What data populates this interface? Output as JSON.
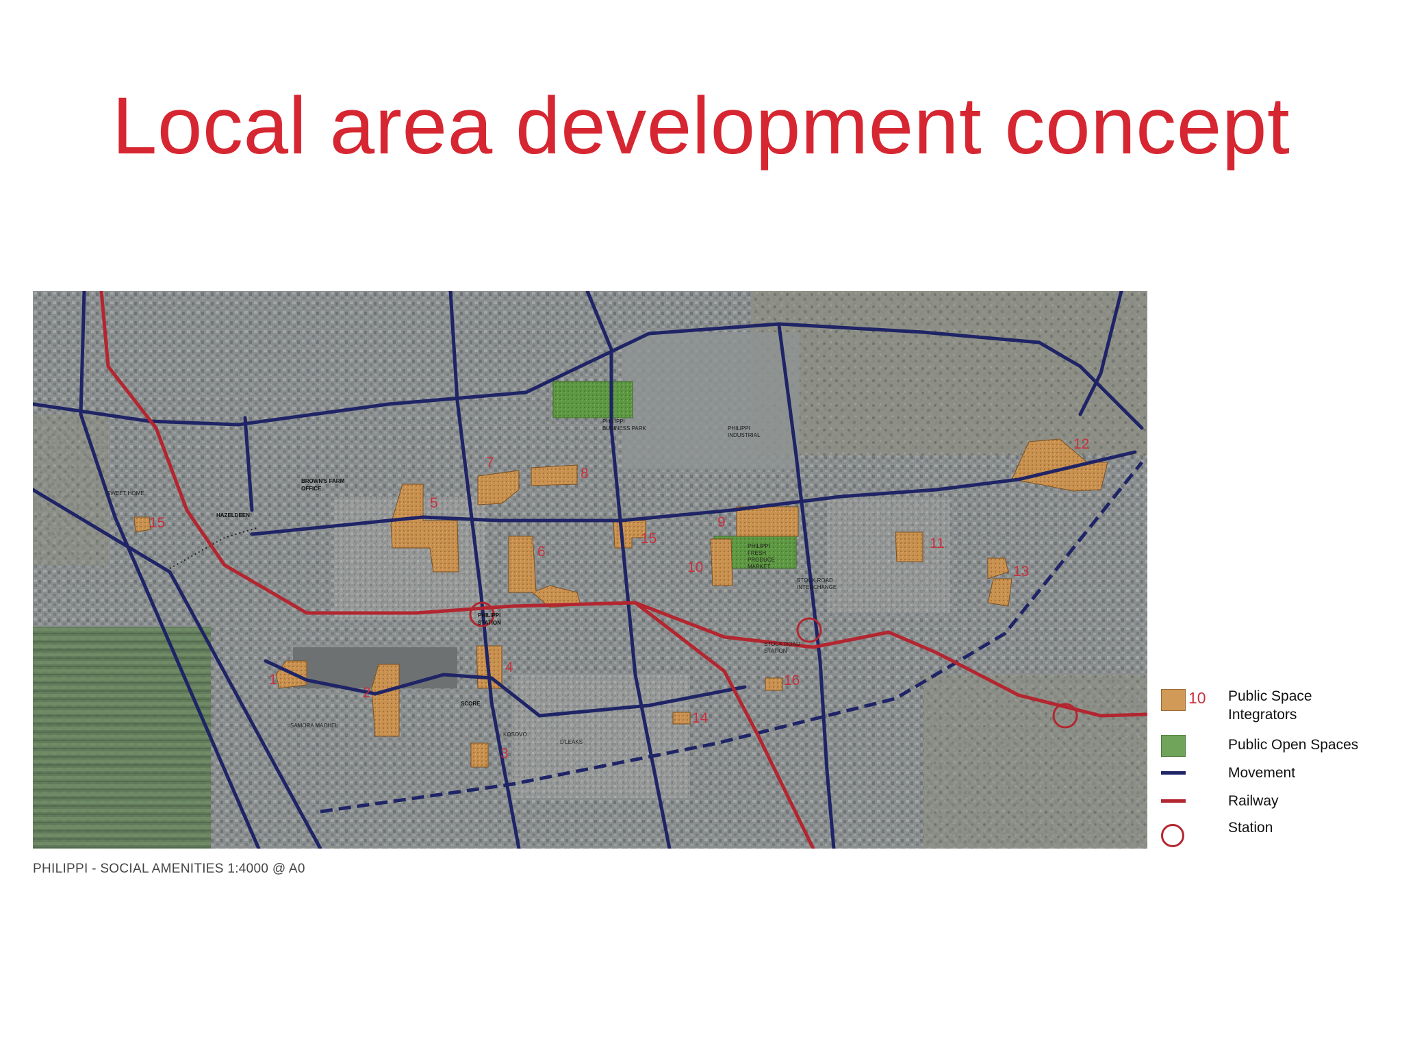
{
  "slide": {
    "title": "Local area development concept",
    "caption": "PHILIPPI - SOCIAL AMENITIES 1:4000 @ A0"
  },
  "colors": {
    "title": "#d62631",
    "integrator_fill": "#d19a57",
    "open_space_fill": "#5f9b45",
    "movement": "#1f2466",
    "railway": "#b3262f",
    "station": "#b3262f",
    "site_number": "#c8303c"
  },
  "map": {
    "place_labels": {
      "sweet_home": "SWEET HOME",
      "hazeldeen": "HAZELDEEN",
      "browns_farm": "BROWN'S FARM",
      "browns_farm_office": "OFFICE",
      "philippi_business_park": "PHILIPPI",
      "business_park": "BUSINESS PARK",
      "philippi_industrial": "PHILIPPI",
      "industrial": "INDUSTRIAL",
      "philippi_station": "PHILIPPI",
      "station": "STATION",
      "stock_road_station": "STOCK ROAD",
      "stock_station": "STATION",
      "stock_interchange": "STOCK ROAD",
      "interchange": "INTERCHANGE",
      "fresh_produce": "PHILIPPI",
      "fresh_produce_2": "FRESH",
      "fresh_produce_3": "PRODUCE",
      "fresh_produce_4": "MARKET",
      "samora_machel": "SAMORA MACHEL",
      "score": "SCORE",
      "kosovo": "KOSOVO",
      "dleaks": "D'LEAKS"
    },
    "site_numbers": [
      "1",
      "2",
      "3",
      "4",
      "5",
      "6",
      "7",
      "8",
      "9",
      "10",
      "11",
      "12",
      "13",
      "14",
      "15",
      "15",
      "16"
    ]
  },
  "legend": {
    "integrators_number": "10",
    "integrators_label_line1": "Public Space",
    "integrators_label_line2": "Integrators",
    "open_spaces_label": "Public Open Spaces",
    "movement_label": "Movement",
    "railway_label": "Railway",
    "station_label": "Station"
  }
}
